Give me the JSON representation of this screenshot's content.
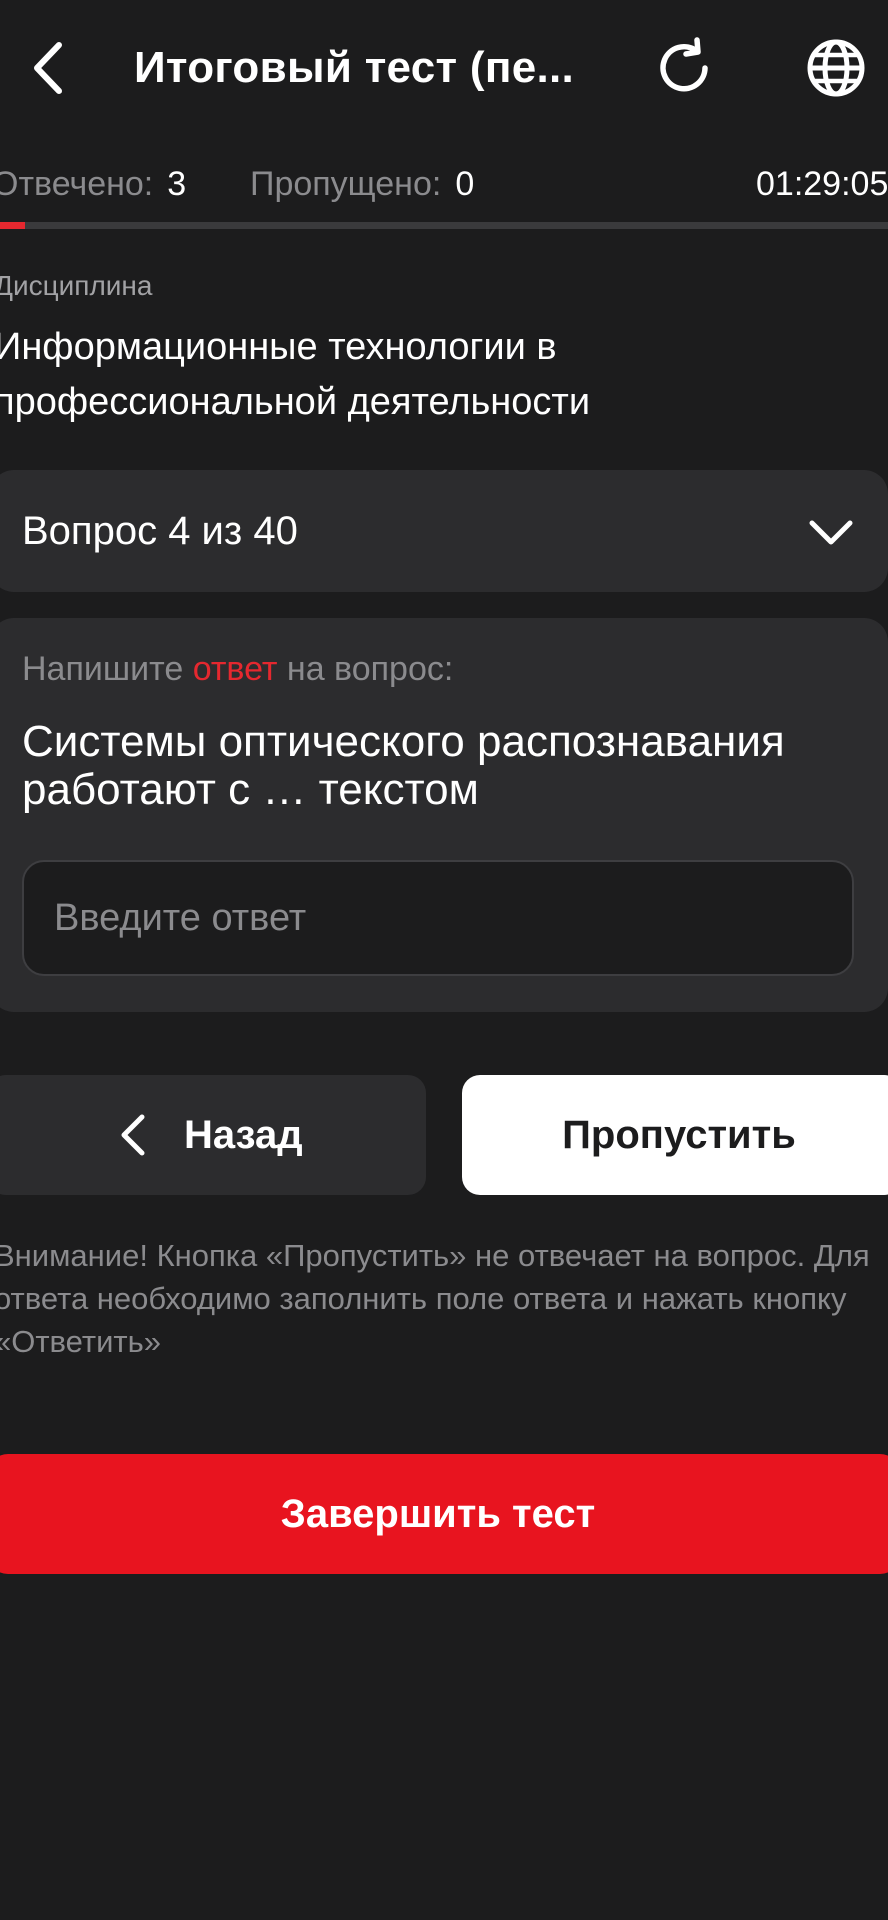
{
  "header": {
    "title": "Итоговый тест (пе...",
    "back_icon": "chevron-left-icon",
    "refresh_icon": "refresh-icon",
    "language_icon": "globe-icon"
  },
  "stats": {
    "answered_label": "Отвечено:",
    "answered_value": "3",
    "skipped_label": "Пропущено:",
    "skipped_value": "0",
    "timer": "01:29:05"
  },
  "progress": {
    "fraction": 0.028,
    "color": "#e5282f"
  },
  "discipline": {
    "label": "Дисциплина",
    "name": "Информационные технологии в профессиональной деятельности"
  },
  "question_selector": {
    "label": "Вопрос 4 из 40",
    "icon": "chevron-down-icon"
  },
  "question": {
    "instruction_before": "Напишите ",
    "instruction_accent": "ответ",
    "instruction_after": " на вопрос:",
    "text": "Системы оптического распознавания работают с … текстом",
    "input_placeholder": "Введите ответ",
    "input_value": ""
  },
  "buttons": {
    "back_label": "Назад",
    "skip_label": "Пропустить",
    "finish_label": "Завершить тест"
  },
  "note": "Внимание! Кнопка «Пропустить» не отвечает на вопрос. Для ответа необходимо заполнить поле ответа и нажать кнопку «Ответить»",
  "colors": {
    "background": "#1c1c1d",
    "card": "#2c2c2e",
    "accent": "#e5282f",
    "finish_button": "#e8141f",
    "muted_text": "#8b8b8e"
  }
}
